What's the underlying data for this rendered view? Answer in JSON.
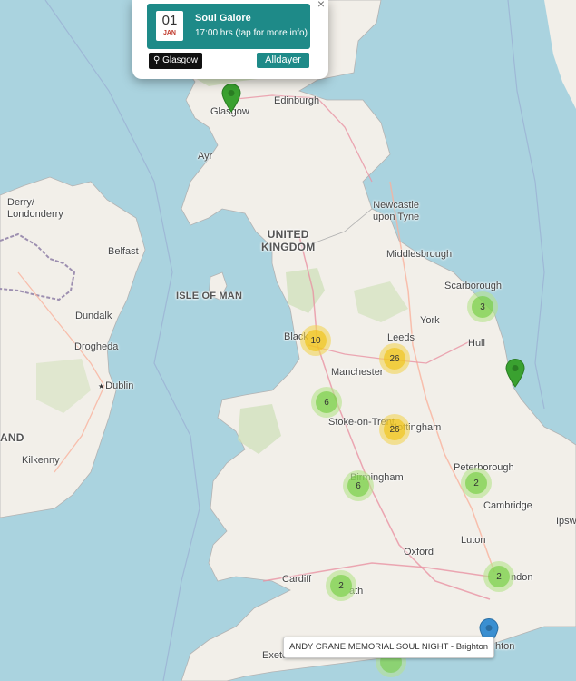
{
  "map": {
    "labels": {
      "edinburgh": "Edinburgh",
      "glasgow": "Glasgow",
      "ayr": "Ayr",
      "derry": "Derry/\nLondonderry",
      "newcastle": "Newcastle\nupon Tyne",
      "belfast": "Belfast",
      "uk": "UNITED\nKINGDOM",
      "middlesbrough": "Middlesbrough",
      "scarborough": "Scarborough",
      "isle_of_man": "ISLE OF MAN",
      "dundalk": "Dundalk",
      "york": "York",
      "hull": "Hull",
      "drogheda": "Drogheda",
      "leeds": "Leeds",
      "blackpool": "Black",
      "manchester": "Manchester",
      "dublin": "Dublin",
      "stoke": "Stoke-on-Trent",
      "nottingham": "Nottingham",
      "ireland_partial": "AND",
      "kilkenny": "Kilkenny",
      "peterborough": "Peterborough",
      "birmingham": "Birmingham",
      "cambridge": "Cambridge",
      "ipswich": "Ipsw",
      "luton": "Luton",
      "oxford": "Oxford",
      "cardiff": "Cardiff",
      "bath": "ath",
      "london": "ndon",
      "exeter": "Exete",
      "brighton": "hton"
    },
    "clusters": [
      {
        "id": "scarborough",
        "count": "3",
        "color": "green"
      },
      {
        "id": "blackpool",
        "count": "10",
        "color": "yellow"
      },
      {
        "id": "leeds",
        "count": "26",
        "color": "yellow"
      },
      {
        "id": "wales-north",
        "count": "6",
        "color": "green"
      },
      {
        "id": "nottingham",
        "count": "26",
        "color": "yellow"
      },
      {
        "id": "birmingham",
        "count": "6",
        "color": "green"
      },
      {
        "id": "peterborough",
        "count": "2",
        "color": "green"
      },
      {
        "id": "london",
        "count": "2",
        "color": "green"
      },
      {
        "id": "bristol",
        "count": "2",
        "color": "green"
      }
    ],
    "markers": [
      {
        "id": "glasgow",
        "color": "#3aa130"
      },
      {
        "id": "east-coast",
        "color": "#3aa130"
      },
      {
        "id": "brighton",
        "color": "#3a8fd1"
      }
    ]
  },
  "popup": {
    "day": "01",
    "month": "JAN",
    "title": "Soul Galore",
    "time": "17:00 hrs (tap for more info)",
    "location": "Glasgow",
    "tag": "Alldayer",
    "close": "×"
  },
  "tooltip": {
    "text": "ANDY CRANE MEMORIAL SOUL NIGHT - Brighton"
  }
}
